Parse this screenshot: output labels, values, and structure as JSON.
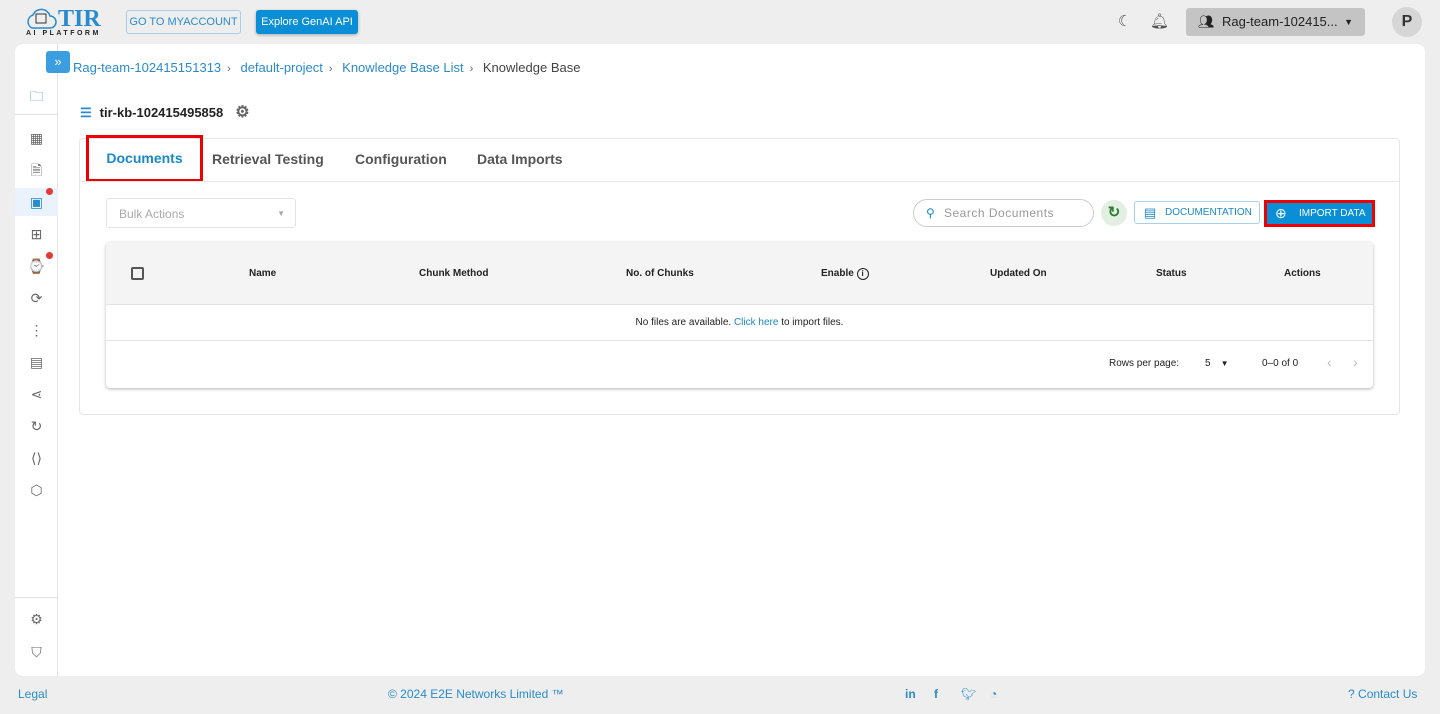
{
  "header": {
    "logo_text": "TIR",
    "logo_sub": "AI PLATFORM",
    "myaccount": "GO TO MYACCOUNT",
    "genai": "Explore GenAI API",
    "team": "Rag-team-102415...",
    "avatar": "P"
  },
  "breadcrumb": [
    "Rag-team-102415151313",
    "default-project",
    "Knowledge Base List",
    "Knowledge Base"
  ],
  "kb_name": "tir-kb-102415495858",
  "tabs": [
    "Documents",
    "Retrieval Testing",
    "Configuration",
    "Data Imports"
  ],
  "toolbar": {
    "bulk": "Bulk Actions",
    "search_placeholder": "Search Documents",
    "documentation": "DOCUMENTATION",
    "import": "IMPORT DATA"
  },
  "table": {
    "columns": [
      "Name",
      "Chunk Method",
      "No. of Chunks",
      "Enable",
      "Updated On",
      "Status",
      "Actions"
    ],
    "empty_text": "No files are available.",
    "empty_link": "Click here",
    "empty_suffix": "to import files.",
    "rows_per_page_label": "Rows per page:",
    "rows_per_page": "5",
    "range": "0–0 of 0"
  },
  "footer": {
    "legal": "Legal",
    "copyright": "© 2024 E2E Networks Limited ™",
    "contact": "Contact Us"
  }
}
